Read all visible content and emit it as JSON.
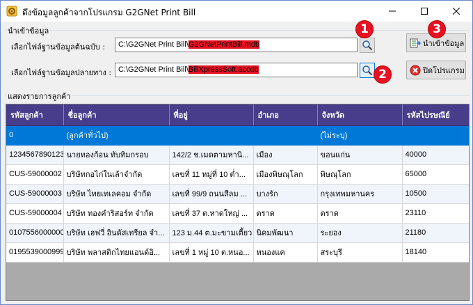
{
  "window": {
    "title": "ดึงข้อมูลลูกค้าจากโปรแกรม G2GNet Print Bill",
    "minimize_label": "Minimize",
    "maximize_label": "Maximize",
    "close_label": "Close"
  },
  "import_group": {
    "label": "นำเข้าข้อมูล",
    "source_label": "เลือกไฟล์ฐานข้อมูลต้นฉบับ :",
    "source_path_prefix": "C:\\G2GNet Print Bill",
    "source_path_sep": "\\",
    "source_path_file": "G2GNetPrintBill.mdb",
    "dest_label": "เลือกไฟล์ฐานข้อมูลปลายทาง :",
    "dest_path_prefix": "C:\\G2GNet Print Bill",
    "dest_path_sep": "\\",
    "dest_path_file": "BillXpressSoft.accdb",
    "import_button": "นำเข้าข้อมูล",
    "close_button": "ปิดโปรแกรม",
    "badges": [
      "1",
      "2",
      "3"
    ]
  },
  "customers_group": {
    "label": "แสดงรายการลูกค้า",
    "columns": [
      "รหัสลูกค้า",
      "ชื่อลูกค้า",
      "ที่อยู่",
      "อำเภอ",
      "จังหวัด",
      "รหัสไปรษณีย์"
    ],
    "rows": [
      [
        "0",
        "(ลูกค้าทั่วไป)",
        "",
        "",
        "(ไม่ระบุ)",
        ""
      ],
      [
        "1234567890123",
        "นายทองก้อน ทับทิมกรอบ",
        "142/2 ช.เมดตามหานิ...",
        "เมือง",
        "ขอนแก่น",
        "40000"
      ],
      [
        "CUS-59000002",
        "บริษัทกอไก่ในเล้าจำกัด",
        "เลขที่ 11 หมู่ที่ 10 ต่ำ...",
        "เมืองพิษณุโลก",
        "พิษณุโลก",
        "65000"
      ],
      [
        "CUS-59000003",
        "บริษัท ไทยเทเลคอม จำกัด",
        "เลขที่ 99/9 ถนนสีลม ...",
        "บางรัก",
        "กรุงเทพมหานคร",
        "10500"
      ],
      [
        "CUS-59000004",
        "บริษัท ทองคำริสอร์ท จำกัด",
        "เลขที่ 37 ต.หาดใหญ่ ...",
        "ตราด",
        "ตราด",
        "23110"
      ],
      [
        "0107556000000",
        "บริษัท เฮฟวี่ อินดัสเทรียล จำ...",
        "123 ม.44 ต.มะขามเตี้ยว",
        "นิคมพัฒนา",
        "ระยอง",
        "21180"
      ],
      [
        "0195539000999",
        "บริษัท พลาสติกไทยแอนด์อิ...",
        "เลขที่ 1 หมู่ 10 ต.หนอ...",
        "หนองแค",
        "สระบุรี",
        "18140"
      ]
    ],
    "selected_row": 0
  },
  "colors": {
    "header_bg": "#483d8b",
    "selected_bg": "#0078d7",
    "highlight": "#e81123",
    "badge": "#e81123"
  },
  "icons": {
    "app": "gear-folder-icon",
    "browse": "magnifier-icon",
    "import": "database-import-icon",
    "close": "close-circle-icon"
  }
}
